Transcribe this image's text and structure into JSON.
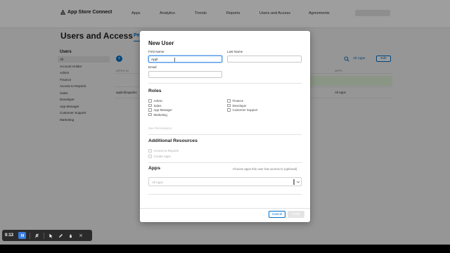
{
  "topbar": {
    "brand": "App Store Connect",
    "nav": [
      "Apps",
      "Analytics",
      "Trends",
      "Reports",
      "Users and Access",
      "Agreements"
    ]
  },
  "page": {
    "title": "Users and Access",
    "tab": "Pe",
    "sidebar_heading": "Users",
    "sidebar_items": [
      "All",
      "Account Holder",
      "Admin",
      "Finance",
      "Access to Reports",
      "Sales",
      "Developer",
      "App Manager",
      "Customer Support",
      "Marketing"
    ],
    "selected_sidebar": "All",
    "add_label": "+",
    "all_apps_label": "All Apps",
    "edit_label": "Edit",
    "columns": [
      "APPLE ID",
      "APPS"
    ],
    "row": {
      "apple_id": "apple@appdev",
      "apps": "All Apps"
    }
  },
  "modal": {
    "title": "New User",
    "first_name_label": "First Name",
    "first_name_value": "Appl",
    "last_name_label": "Last Name",
    "last_name_value": "",
    "email_label": "Email",
    "email_value": "",
    "roles_title": "Roles",
    "roles": [
      "Admin",
      "Sales",
      "App Manager",
      "Marketing",
      "Finance",
      "Developer",
      "Customer Support"
    ],
    "see_permissions": "See Permissions",
    "additional_title": "Additional Resources",
    "additional": [
      "Access to Reports",
      "Create Apps"
    ],
    "apps_title": "Apps",
    "apps_hint": "Choose apps this user has access to (optional)",
    "apps_select": "All Apps",
    "cancel_label": "Cancel",
    "invite_label": "Invite"
  },
  "recorder": {
    "time": "0:13"
  },
  "colors": {
    "accent": "#0070c9",
    "focus": "#5b9ee8",
    "recorder_active": "#3a7be0"
  }
}
